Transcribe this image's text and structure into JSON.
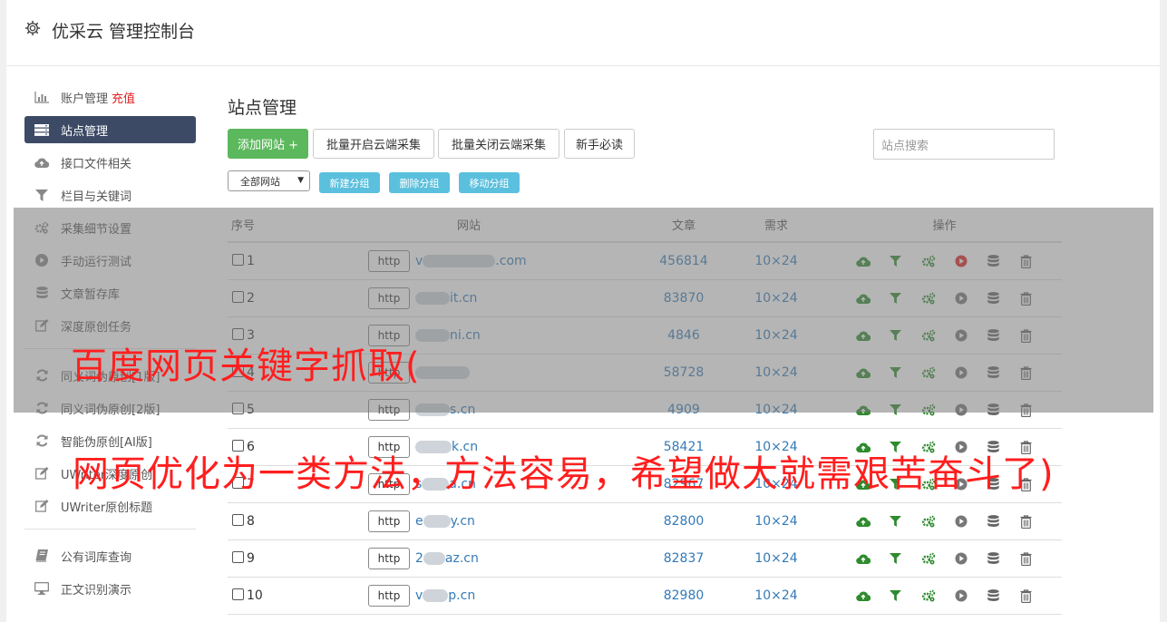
{
  "app": {
    "title": "优采云 管理控制台"
  },
  "sidebar": {
    "items": [
      {
        "label": "账户管理",
        "extra": "充值",
        "icon": "bar-chart-icon"
      },
      {
        "label": "站点管理",
        "icon": "list-icon",
        "active": true
      },
      {
        "label": "接口文件相关",
        "icon": "cloud-upload-icon"
      },
      {
        "label": "栏目与关键词",
        "icon": "filter-icon"
      },
      {
        "label": "采集细节设置",
        "icon": "cogs-icon"
      },
      {
        "label": "手动运行测试",
        "icon": "play-icon"
      },
      {
        "label": "文章暂存库",
        "icon": "database-icon"
      },
      {
        "label": "深度原创任务",
        "icon": "edit-icon"
      }
    ],
    "items2": [
      {
        "label": "同义词伪原创[1版]",
        "icon": "refresh-icon"
      },
      {
        "label": "同义词伪原创[2版]",
        "icon": "refresh-icon"
      },
      {
        "label": "智能伪原创[AI版]",
        "icon": "refresh-icon"
      },
      {
        "label": "UWriter深度原创",
        "icon": "edit-icon"
      },
      {
        "label": "UWriter原创标题",
        "icon": "edit-icon"
      }
    ],
    "items3": [
      {
        "label": "公有词库查询",
        "icon": "book-icon"
      },
      {
        "label": "正文识别演示",
        "icon": "monitor-icon"
      }
    ]
  },
  "main": {
    "title": "站点管理",
    "buttons": {
      "add": "添加网站 +",
      "batch_on": "批量开启云端采集",
      "batch_off": "批量关闭云端采集",
      "guide": "新手必读"
    },
    "search_placeholder": "站点搜索",
    "group_select": "全部网站",
    "group_buttons": {
      "new": "新建分组",
      "delete": "删除分组",
      "move": "移动分组"
    },
    "table": {
      "headers": [
        "序号",
        "网站",
        "文章",
        "需求",
        "操作"
      ],
      "rows": [
        {
          "seq": "1",
          "scheme": "http",
          "prefix": "v",
          "suffix": ".com",
          "articles": "456814",
          "demand": "10×24",
          "blur": 80,
          "run_color": "#e02020"
        },
        {
          "seq": "2",
          "scheme": "http",
          "prefix": "",
          "suffix": "it.cn",
          "articles": "83870",
          "demand": "10×24",
          "blur": 38,
          "run_color": "#777777"
        },
        {
          "seq": "3",
          "scheme": "http",
          "prefix": "",
          "suffix": "ni.cn",
          "articles": "4846",
          "demand": "10×24",
          "blur": 38,
          "run_color": "#777777"
        },
        {
          "seq": "4",
          "scheme": "http",
          "prefix": "",
          "suffix": "",
          "articles": "58728",
          "demand": "10×24",
          "blur": 60,
          "run_color": "#777777"
        },
        {
          "seq": "5",
          "scheme": "http",
          "prefix": "",
          "suffix": "s.cn",
          "articles": "4909",
          "demand": "10×24",
          "blur": 38,
          "run_color": "#777777"
        },
        {
          "seq": "6",
          "scheme": "http",
          "prefix": "",
          "suffix": "k.cn",
          "articles": "58421",
          "demand": "10×24",
          "blur": 40,
          "run_color": "#777777"
        },
        {
          "seq": "7",
          "scheme": "http",
          "prefix": "s",
          "suffix": "a.cn",
          "articles": "82967",
          "demand": "10×24",
          "blur": 30,
          "run_color": "#777777"
        },
        {
          "seq": "8",
          "scheme": "http",
          "prefix": "e",
          "suffix": "y.cn",
          "articles": "82800",
          "demand": "10×24",
          "blur": 30,
          "run_color": "#777777"
        },
        {
          "seq": "9",
          "scheme": "http",
          "prefix": "2",
          "suffix": "az.cn",
          "articles": "82837",
          "demand": "10×24",
          "blur": 24,
          "run_color": "#777777"
        },
        {
          "seq": "10",
          "scheme": "http",
          "prefix": "v",
          "suffix": "p.cn",
          "articles": "82980",
          "demand": "10×24",
          "blur": 28,
          "run_color": "#777777"
        }
      ]
    }
  },
  "overlay": {
    "line1": "百度网页关键字抓取(",
    "line2": "网页优化为一类方法，方法容易，希望做大就需艰苦奋斗了)"
  },
  "colors": {
    "accent": "#3c4a65",
    "green": "#5cb85c",
    "info": "#5bc0de",
    "link": "#337ab7",
    "overlay_text": "#ff1e1e"
  }
}
